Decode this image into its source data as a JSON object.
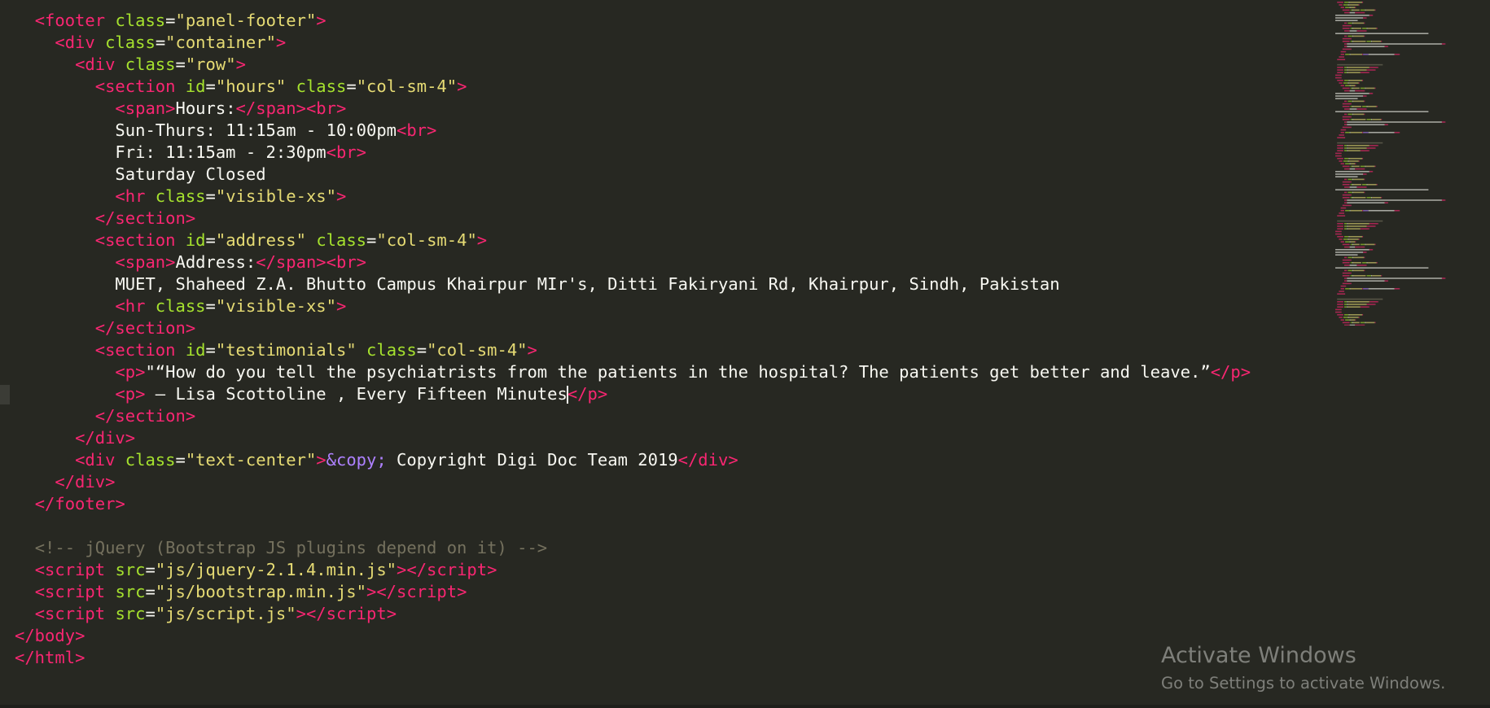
{
  "editor": {
    "lines": [
      [
        {
          "c": "plain",
          "t": "  "
        },
        {
          "c": "tag",
          "t": "<footer"
        },
        {
          "c": "plain",
          "t": " "
        },
        {
          "c": "attr",
          "t": "class"
        },
        {
          "c": "plain",
          "t": "="
        },
        {
          "c": "str",
          "t": "\"panel-footer\""
        },
        {
          "c": "tag",
          "t": ">"
        }
      ],
      [
        {
          "c": "plain",
          "t": "    "
        },
        {
          "c": "tag",
          "t": "<div"
        },
        {
          "c": "plain",
          "t": " "
        },
        {
          "c": "attr",
          "t": "class"
        },
        {
          "c": "plain",
          "t": "="
        },
        {
          "c": "str",
          "t": "\"container\""
        },
        {
          "c": "tag",
          "t": ">"
        }
      ],
      [
        {
          "c": "plain",
          "t": "      "
        },
        {
          "c": "tag",
          "t": "<div"
        },
        {
          "c": "plain",
          "t": " "
        },
        {
          "c": "attr",
          "t": "class"
        },
        {
          "c": "plain",
          "t": "="
        },
        {
          "c": "str",
          "t": "\"row\""
        },
        {
          "c": "tag",
          "t": ">"
        }
      ],
      [
        {
          "c": "plain",
          "t": "        "
        },
        {
          "c": "tag",
          "t": "<section"
        },
        {
          "c": "plain",
          "t": " "
        },
        {
          "c": "attr",
          "t": "id"
        },
        {
          "c": "plain",
          "t": "="
        },
        {
          "c": "str",
          "t": "\"hours\""
        },
        {
          "c": "plain",
          "t": " "
        },
        {
          "c": "attr",
          "t": "class"
        },
        {
          "c": "plain",
          "t": "="
        },
        {
          "c": "str",
          "t": "\"col-sm-4\""
        },
        {
          "c": "tag",
          "t": ">"
        }
      ],
      [
        {
          "c": "plain",
          "t": "          "
        },
        {
          "c": "tag",
          "t": "<span"
        },
        {
          "c": "tag",
          "t": ">"
        },
        {
          "c": "plain",
          "t": "Hours:"
        },
        {
          "c": "tag",
          "t": "</span"
        },
        {
          "c": "tag",
          "t": ">"
        },
        {
          "c": "tag",
          "t": "<br"
        },
        {
          "c": "tag",
          "t": ">"
        }
      ],
      [
        {
          "c": "plain",
          "t": "          Sun-Thurs: 11:15am - 10:00pm"
        },
        {
          "c": "tag",
          "t": "<br"
        },
        {
          "c": "tag",
          "t": ">"
        }
      ],
      [
        {
          "c": "plain",
          "t": "          Fri: 11:15am - 2:30pm"
        },
        {
          "c": "tag",
          "t": "<br"
        },
        {
          "c": "tag",
          "t": ">"
        }
      ],
      [
        {
          "c": "plain",
          "t": "          Saturday Closed"
        }
      ],
      [
        {
          "c": "plain",
          "t": "          "
        },
        {
          "c": "tag",
          "t": "<hr"
        },
        {
          "c": "plain",
          "t": " "
        },
        {
          "c": "attr",
          "t": "class"
        },
        {
          "c": "plain",
          "t": "="
        },
        {
          "c": "str",
          "t": "\"visible-xs\""
        },
        {
          "c": "tag",
          "t": ">"
        }
      ],
      [
        {
          "c": "plain",
          "t": "        "
        },
        {
          "c": "tag",
          "t": "</section"
        },
        {
          "c": "tag",
          "t": ">"
        }
      ],
      [
        {
          "c": "plain",
          "t": "        "
        },
        {
          "c": "tag",
          "t": "<section"
        },
        {
          "c": "plain",
          "t": " "
        },
        {
          "c": "attr",
          "t": "id"
        },
        {
          "c": "plain",
          "t": "="
        },
        {
          "c": "str",
          "t": "\"address\""
        },
        {
          "c": "plain",
          "t": " "
        },
        {
          "c": "attr",
          "t": "class"
        },
        {
          "c": "plain",
          "t": "="
        },
        {
          "c": "str",
          "t": "\"col-sm-4\""
        },
        {
          "c": "tag",
          "t": ">"
        }
      ],
      [
        {
          "c": "plain",
          "t": "          "
        },
        {
          "c": "tag",
          "t": "<span"
        },
        {
          "c": "tag",
          "t": ">"
        },
        {
          "c": "plain",
          "t": "Address:"
        },
        {
          "c": "tag",
          "t": "</span"
        },
        {
          "c": "tag",
          "t": ">"
        },
        {
          "c": "tag",
          "t": "<br"
        },
        {
          "c": "tag",
          "t": ">"
        }
      ],
      [
        {
          "c": "plain",
          "t": "          MUET, Shaheed Z.A. Bhutto Campus Khairpur MIr's, Ditti Fakiryani Rd, Khairpur, Sindh, Pakistan"
        }
      ],
      [
        {
          "c": "plain",
          "t": "          "
        },
        {
          "c": "tag",
          "t": "<hr"
        },
        {
          "c": "plain",
          "t": " "
        },
        {
          "c": "attr",
          "t": "class"
        },
        {
          "c": "plain",
          "t": "="
        },
        {
          "c": "str",
          "t": "\"visible-xs\""
        },
        {
          "c": "tag",
          "t": ">"
        }
      ],
      [
        {
          "c": "plain",
          "t": "        "
        },
        {
          "c": "tag",
          "t": "</section"
        },
        {
          "c": "tag",
          "t": ">"
        }
      ],
      [
        {
          "c": "plain",
          "t": "        "
        },
        {
          "c": "tag",
          "t": "<section"
        },
        {
          "c": "plain",
          "t": " "
        },
        {
          "c": "attr",
          "t": "id"
        },
        {
          "c": "plain",
          "t": "="
        },
        {
          "c": "str",
          "t": "\"testimonials\""
        },
        {
          "c": "plain",
          "t": " "
        },
        {
          "c": "attr",
          "t": "class"
        },
        {
          "c": "plain",
          "t": "="
        },
        {
          "c": "str",
          "t": "\"col-sm-4\""
        },
        {
          "c": "tag",
          "t": ">"
        }
      ],
      [
        {
          "c": "plain",
          "t": "          "
        },
        {
          "c": "tag",
          "t": "<p"
        },
        {
          "c": "tag",
          "t": ">"
        },
        {
          "c": "plain",
          "t": "\"“How do you tell the psychiatrists from the patients in the hospital? The patients get better and leave.”"
        },
        {
          "c": "tag",
          "t": "</p"
        },
        {
          "c": "tag",
          "t": ">"
        }
      ],
      [
        {
          "c": "plain",
          "t": "          "
        },
        {
          "c": "tag",
          "t": "<p"
        },
        {
          "c": "tag",
          "t": ">"
        },
        {
          "c": "plain",
          "t": " — Lisa Scottoline , Every Fifteen Minutes"
        },
        {
          "c": "cursor",
          "t": ""
        },
        {
          "c": "tag",
          "t": "</p"
        },
        {
          "c": "tag",
          "t": ">"
        }
      ],
      [
        {
          "c": "plain",
          "t": "        "
        },
        {
          "c": "tag",
          "t": "</section"
        },
        {
          "c": "tag",
          "t": ">"
        }
      ],
      [
        {
          "c": "plain",
          "t": "      "
        },
        {
          "c": "tag",
          "t": "</div"
        },
        {
          "c": "tag",
          "t": ">"
        }
      ],
      [
        {
          "c": "plain",
          "t": "      "
        },
        {
          "c": "tag",
          "t": "<div"
        },
        {
          "c": "plain",
          "t": " "
        },
        {
          "c": "attr",
          "t": "class"
        },
        {
          "c": "plain",
          "t": "="
        },
        {
          "c": "str",
          "t": "\"text-center\""
        },
        {
          "c": "tag",
          "t": ">"
        },
        {
          "c": "ent",
          "t": "&copy;"
        },
        {
          "c": "plain",
          "t": " Copyright Digi Doc Team 2019"
        },
        {
          "c": "tag",
          "t": "</div"
        },
        {
          "c": "tag",
          "t": ">"
        }
      ],
      [
        {
          "c": "plain",
          "t": "    "
        },
        {
          "c": "tag",
          "t": "</div"
        },
        {
          "c": "tag",
          "t": ">"
        }
      ],
      [
        {
          "c": "plain",
          "t": "  "
        },
        {
          "c": "tag",
          "t": "</footer"
        },
        {
          "c": "tag",
          "t": ">"
        }
      ],
      [
        {
          "c": "plain",
          "t": ""
        }
      ],
      [
        {
          "c": "plain",
          "t": "  "
        },
        {
          "c": "cmt",
          "t": "<!-- jQuery (Bootstrap JS plugins depend on it) -->"
        }
      ],
      [
        {
          "c": "plain",
          "t": "  "
        },
        {
          "c": "tag",
          "t": "<script"
        },
        {
          "c": "plain",
          "t": " "
        },
        {
          "c": "attr",
          "t": "src"
        },
        {
          "c": "plain",
          "t": "="
        },
        {
          "c": "str",
          "t": "\"js/jquery-2.1.4.min.js\""
        },
        {
          "c": "tag",
          "t": ">"
        },
        {
          "c": "tag",
          "t": "</script"
        },
        {
          "c": "tag",
          "t": ">"
        }
      ],
      [
        {
          "c": "plain",
          "t": "  "
        },
        {
          "c": "tag",
          "t": "<script"
        },
        {
          "c": "plain",
          "t": " "
        },
        {
          "c": "attr",
          "t": "src"
        },
        {
          "c": "plain",
          "t": "="
        },
        {
          "c": "str",
          "t": "\"js/bootstrap.min.js\""
        },
        {
          "c": "tag",
          "t": ">"
        },
        {
          "c": "tag",
          "t": "</script"
        },
        {
          "c": "tag",
          "t": ">"
        }
      ],
      [
        {
          "c": "plain",
          "t": "  "
        },
        {
          "c": "tag",
          "t": "<script"
        },
        {
          "c": "plain",
          "t": " "
        },
        {
          "c": "attr",
          "t": "src"
        },
        {
          "c": "plain",
          "t": "="
        },
        {
          "c": "str",
          "t": "\"js/script.js\""
        },
        {
          "c": "tag",
          "t": ">"
        },
        {
          "c": "tag",
          "t": "</script"
        },
        {
          "c": "tag",
          "t": ">"
        }
      ],
      [
        {
          "c": "tag",
          "t": "</body"
        },
        {
          "c": "tag",
          "t": ">"
        }
      ],
      [
        {
          "c": "tag",
          "t": "</html"
        },
        {
          "c": "tag",
          "t": ">"
        }
      ]
    ]
  },
  "watermark": {
    "title": "Activate Windows",
    "subtitle": "Go to Settings to activate Windows."
  },
  "colors": {
    "background": "#272822",
    "tag": "#f92672",
    "attribute": "#a6e22e",
    "string": "#e6db74",
    "entity": "#ae81ff",
    "comment": "#75715e",
    "text": "#f8f8f2"
  }
}
